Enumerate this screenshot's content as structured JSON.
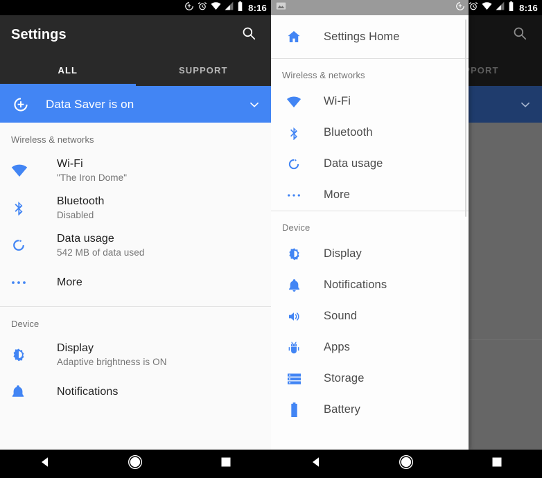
{
  "statusbar": {
    "time": "8:16",
    "icons": [
      "data-saver-icon",
      "alarm-icon",
      "wifi-icon",
      "cellular-icon",
      "battery-icon"
    ],
    "notification_icon": "screenshot-image-icon"
  },
  "colors": {
    "accent_blue": "#4285f4",
    "appbar_dark": "#292929",
    "scrim_gray": "#666666",
    "list_bg": "#fafafa",
    "drawer_bg": "#fdfdfd"
  },
  "appbar": {
    "title": "Settings",
    "search_label": "search-icon"
  },
  "tabs": [
    {
      "label": "ALL",
      "active": true
    },
    {
      "label": "SUPPORT",
      "active": false
    }
  ],
  "banner": {
    "icon": "data-saver-icon",
    "text": "Data Saver is on",
    "chevron": "chevron-down-icon"
  },
  "settings_list": {
    "sections": [
      {
        "header": "Wireless & networks",
        "rows": [
          {
            "icon": "wifi-icon",
            "title": "Wi-Fi",
            "subtitle": "\"The Iron Dome\""
          },
          {
            "icon": "bluetooth-icon",
            "title": "Bluetooth",
            "subtitle": "Disabled"
          },
          {
            "icon": "data-usage-icon",
            "title": "Data usage",
            "subtitle": "542 MB of data used"
          },
          {
            "icon": "more-icon",
            "title": "More",
            "subtitle": ""
          }
        ]
      },
      {
        "header": "Device",
        "rows": [
          {
            "icon": "display-icon",
            "title": "Display",
            "subtitle": "Adaptive brightness is ON"
          },
          {
            "icon": "notifications-icon",
            "title": "Notifications",
            "subtitle": ""
          }
        ]
      }
    ]
  },
  "drawer": {
    "home": {
      "icon": "home-icon",
      "label": "Settings Home"
    },
    "sections": [
      {
        "header": "Wireless & networks",
        "items": [
          {
            "icon": "wifi-icon",
            "label": "Wi-Fi"
          },
          {
            "icon": "bluetooth-icon",
            "label": "Bluetooth"
          },
          {
            "icon": "data-usage-icon",
            "label": "Data usage"
          },
          {
            "icon": "more-icon",
            "label": "More"
          }
        ]
      },
      {
        "header": "Device",
        "items": [
          {
            "icon": "display-icon",
            "label": "Display"
          },
          {
            "icon": "notifications-icon",
            "label": "Notifications"
          },
          {
            "icon": "sound-icon",
            "label": "Sound"
          },
          {
            "icon": "apps-icon",
            "label": "Apps"
          },
          {
            "icon": "storage-icon",
            "label": "Storage"
          },
          {
            "icon": "battery-icon",
            "label": "Battery"
          }
        ]
      }
    ]
  },
  "navbar": {
    "back": "back-triangle-icon",
    "home": "home-circle-icon",
    "recents": "recents-square-icon"
  }
}
